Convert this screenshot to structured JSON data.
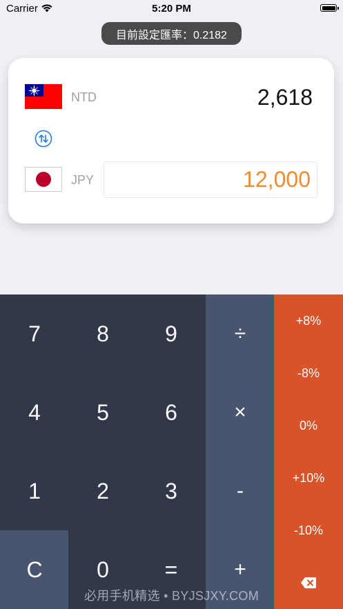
{
  "status_bar": {
    "carrier": "Carrier",
    "time": "5:20 PM"
  },
  "rate_banner": {
    "text": "目前設定匯率：0.2182"
  },
  "converter": {
    "top": {
      "code": "NTD",
      "amount": "2,618",
      "flag": "taiwan-flag"
    },
    "bottom": {
      "code": "JPY",
      "amount": "12,000",
      "flag": "japan-flag"
    },
    "swap_icon": "swap-arrows-icon",
    "accent_color": "#f28a2e"
  },
  "keypad": {
    "digits": {
      "seven": "7",
      "eight": "8",
      "nine": "9",
      "four": "4",
      "five": "5",
      "six": "6",
      "one": "1",
      "two": "2",
      "three": "3",
      "zero": "0"
    },
    "clear": "C",
    "equals": "=",
    "operators": {
      "divide": "÷",
      "multiply": "×",
      "minus": "-",
      "plus": "+"
    },
    "percents": [
      "+8%",
      "-8%",
      "0%",
      "+10%",
      "-10%"
    ],
    "backspace_icon": "backspace-icon",
    "colors": {
      "dark": "#30384a",
      "mid": "#49556f",
      "orange": "#d9532a"
    }
  },
  "watermark": "必用手机精选 • BYJSJXY.COM"
}
